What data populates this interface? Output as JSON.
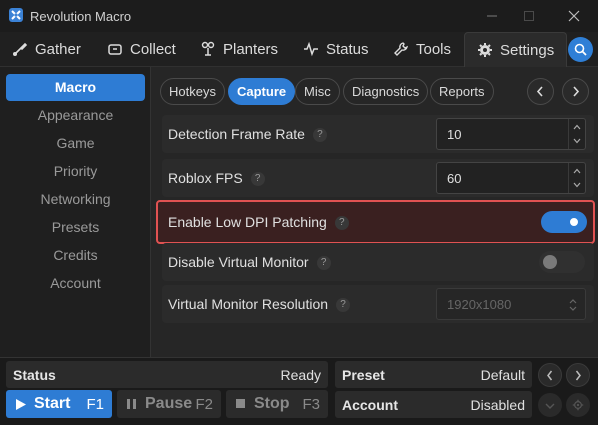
{
  "window": {
    "title": "Revolution Macro"
  },
  "tabs": [
    {
      "label": "Gather",
      "icon": "brush-icon"
    },
    {
      "label": "Collect",
      "icon": "collect-icon"
    },
    {
      "label": "Planters",
      "icon": "planter-icon"
    },
    {
      "label": "Status",
      "icon": "pulse-icon"
    },
    {
      "label": "Tools",
      "icon": "wrench-icon"
    },
    {
      "label": "Settings",
      "icon": "gear-icon",
      "active": true
    }
  ],
  "sidebar": {
    "items": [
      {
        "label": "Macro",
        "active": true
      },
      {
        "label": "Appearance"
      },
      {
        "label": "Game"
      },
      {
        "label": "Priority"
      },
      {
        "label": "Networking"
      },
      {
        "label": "Presets"
      },
      {
        "label": "Credits"
      },
      {
        "label": "Account"
      }
    ]
  },
  "subtabs": [
    {
      "label": "Hotkeys"
    },
    {
      "label": "Capture",
      "active": true
    },
    {
      "label": "Misc"
    },
    {
      "label": "Diagnostics"
    },
    {
      "label": "Reports"
    }
  ],
  "settings": {
    "detection_frame_rate": {
      "label": "Detection Frame Rate",
      "value": "10"
    },
    "roblox_fps": {
      "label": "Roblox FPS",
      "value": "60"
    },
    "low_dpi": {
      "label": "Enable Low DPI Patching",
      "enabled": true
    },
    "disable_vm": {
      "label": "Disable Virtual Monitor",
      "enabled": false
    },
    "vm_resolution": {
      "label": "Virtual Monitor Resolution",
      "value": "1920x1080",
      "disabled": true
    },
    "help_glyph": "?"
  },
  "bottom": {
    "status_label": "Status",
    "status_value": "Ready",
    "preset_label": "Preset",
    "preset_value": "Default",
    "account_label": "Account",
    "account_value": "Disabled",
    "start_label": "Start",
    "start_key": "F1",
    "pause_label": "Pause",
    "pause_key": "F2",
    "stop_label": "Stop",
    "stop_key": "F3"
  },
  "colors": {
    "accent": "#2e7cd4",
    "highlight_border": "#e05252",
    "highlight_bg": "#3a2020"
  }
}
